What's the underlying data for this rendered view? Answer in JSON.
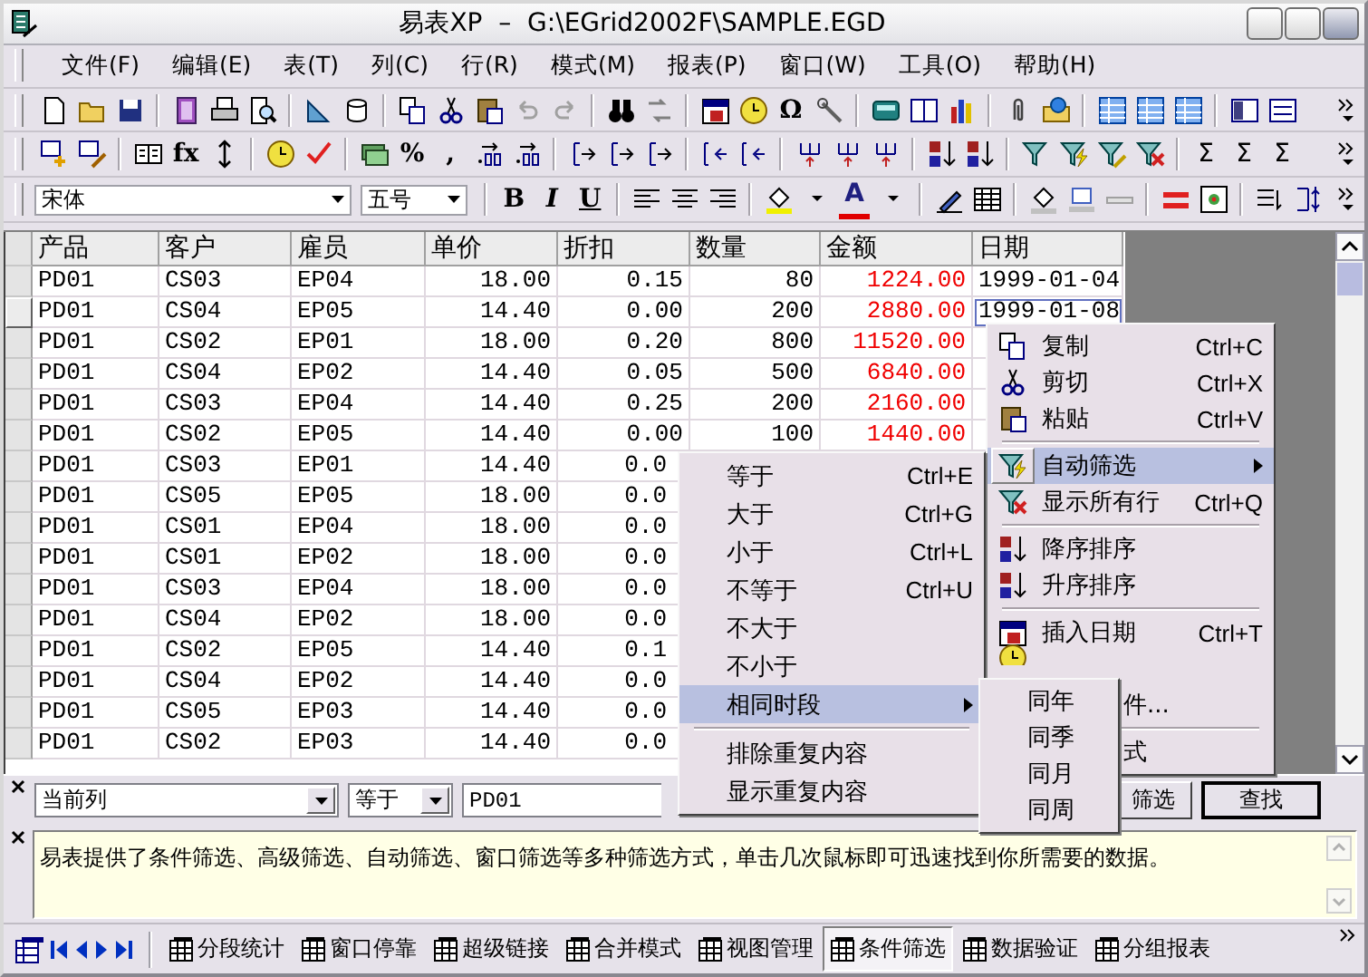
{
  "window": {
    "title": "易表XP  –  G:\\EGrid2002F\\SAMPLE.EGD"
  },
  "menu_bar": [
    "文件(F)",
    "编辑(E)",
    "表(T)",
    "列(C)",
    "行(R)",
    "模式(M)",
    "报表(P)",
    "窗口(W)",
    "工具(O)",
    "帮助(H)"
  ],
  "toolbars": {
    "omega": "Ω",
    "fx": "fx",
    "percent": "%",
    "comma": ",",
    "sigma": [
      "Σ",
      "Σ",
      "Σ"
    ],
    "font": "宋体",
    "size": "五号",
    "bold": "B",
    "italic": "I",
    "underline": "U",
    "font_color": "A"
  },
  "table": {
    "columns": [
      "产品",
      "客户",
      "雇员",
      "单价",
      "折扣",
      "数量",
      "金额",
      "日期"
    ],
    "rows": [
      {
        "selected": false,
        "covered": false,
        "cells": [
          "PD01",
          "CS03",
          "EP04",
          "18.00",
          "0.15",
          "80",
          "1224.00",
          "1999-01-04"
        ]
      },
      {
        "selected": true,
        "covered": false,
        "cells": [
          "PD01",
          "CS04",
          "EP05",
          "14.40",
          "0.00",
          "200",
          "2880.00",
          "1999-01-08"
        ]
      },
      {
        "selected": false,
        "covered": false,
        "cells": [
          "PD01",
          "CS02",
          "EP01",
          "18.00",
          "0.20",
          "800",
          "11520.00"
        ]
      },
      {
        "selected": false,
        "covered": false,
        "cells": [
          "PD01",
          "CS04",
          "EP02",
          "14.40",
          "0.05",
          "500",
          "6840.00"
        ]
      },
      {
        "selected": false,
        "covered": false,
        "cells": [
          "PD01",
          "CS03",
          "EP04",
          "14.40",
          "0.25",
          "200",
          "2160.00"
        ]
      },
      {
        "selected": false,
        "covered": false,
        "cells": [
          "PD01",
          "CS02",
          "EP05",
          "14.40",
          "0.00",
          "100",
          "1440.00"
        ]
      },
      {
        "selected": false,
        "covered": true,
        "cells": [
          "PD01",
          "CS03",
          "EP01",
          "14.40",
          "0.0"
        ]
      },
      {
        "selected": false,
        "covered": true,
        "cells": [
          "PD01",
          "CS05",
          "EP05",
          "18.00",
          "0.0"
        ]
      },
      {
        "selected": false,
        "covered": true,
        "cells": [
          "PD01",
          "CS01",
          "EP04",
          "18.00",
          "0.0"
        ]
      },
      {
        "selected": false,
        "covered": true,
        "cells": [
          "PD01",
          "CS01",
          "EP02",
          "18.00",
          "0.0"
        ]
      },
      {
        "selected": false,
        "covered": true,
        "cells": [
          "PD01",
          "CS03",
          "EP04",
          "18.00",
          "0.0"
        ]
      },
      {
        "selected": false,
        "covered": true,
        "cells": [
          "PD01",
          "CS04",
          "EP02",
          "18.00",
          "0.0"
        ]
      },
      {
        "selected": false,
        "covered": true,
        "cells": [
          "PD01",
          "CS02",
          "EP05",
          "14.40",
          "0.1"
        ]
      },
      {
        "selected": false,
        "covered": true,
        "cells": [
          "PD01",
          "CS04",
          "EP02",
          "14.40",
          "0.0"
        ]
      },
      {
        "selected": false,
        "covered": true,
        "cells": [
          "PD01",
          "CS05",
          "EP03",
          "14.40",
          "0.0"
        ]
      },
      {
        "selected": false,
        "covered": true,
        "cells": [
          "PD01",
          "CS02",
          "EP03",
          "14.40",
          "0.0"
        ]
      }
    ]
  },
  "context_menu": {
    "items": [
      {
        "kind": "item",
        "label": "复制",
        "shortcut": "Ctrl+C",
        "selected": false,
        "submenu": false
      },
      {
        "kind": "item",
        "label": "剪切",
        "shortcut": "Ctrl+X",
        "selected": false,
        "submenu": false
      },
      {
        "kind": "item",
        "label": "粘贴",
        "shortcut": "Ctrl+V",
        "selected": false,
        "submenu": false
      },
      {
        "kind": "separator"
      },
      {
        "kind": "item",
        "label": "自动筛选",
        "selected": true,
        "submenu": true
      },
      {
        "kind": "item",
        "label": "显示所有行",
        "shortcut": "Ctrl+Q",
        "selected": false,
        "submenu": false
      },
      {
        "kind": "separator"
      },
      {
        "kind": "item",
        "label": "降序排序",
        "selected": false,
        "submenu": false
      },
      {
        "kind": "item",
        "label": "升序排序",
        "selected": false,
        "submenu": false
      },
      {
        "kind": "separator"
      },
      {
        "kind": "item",
        "label": "插入日期",
        "shortcut": "Ctrl+T",
        "selected": false,
        "submenu": false
      },
      {
        "kind": "covered"
      },
      {
        "kind": "partial",
        "label": "件..."
      },
      {
        "kind": "separator"
      },
      {
        "kind": "partial",
        "label": "式"
      }
    ]
  },
  "filter_submenu": {
    "items": [
      {
        "kind": "item",
        "label": "等于",
        "shortcut": "Ctrl+E",
        "selected": false,
        "submenu": false
      },
      {
        "kind": "item",
        "label": "大于",
        "shortcut": "Ctrl+G",
        "selected": false,
        "submenu": false
      },
      {
        "kind": "item",
        "label": "小于",
        "shortcut": "Ctrl+L",
        "selected": false,
        "submenu": false
      },
      {
        "kind": "item",
        "label": "不等于",
        "shortcut": "Ctrl+U",
        "selected": false,
        "submenu": false
      },
      {
        "kind": "item",
        "label": "不大于",
        "selected": false,
        "submenu": false
      },
      {
        "kind": "item",
        "label": "不小于",
        "selected": false,
        "submenu": false
      },
      {
        "kind": "item",
        "label": "相同时段",
        "selected": true,
        "submenu": true
      },
      {
        "kind": "separator"
      },
      {
        "kind": "item",
        "label": "排除重复内容",
        "selected": false,
        "submenu": false
      },
      {
        "kind": "item",
        "label": "显示重复内容",
        "selected": false,
        "submenu": false
      }
    ]
  },
  "period_submenu": {
    "items": [
      {
        "kind": "item",
        "label": "同年",
        "selected": false,
        "submenu": false
      },
      {
        "kind": "item",
        "label": "同季",
        "selected": false,
        "submenu": false
      },
      {
        "kind": "item",
        "label": "同月",
        "selected": false,
        "submenu": false
      },
      {
        "kind": "item",
        "label": "同周",
        "selected": false,
        "submenu": false
      }
    ]
  },
  "filter_bar": {
    "scope": "当前列",
    "operator": "等于",
    "value": "PD01",
    "buttons": [
      "筛选",
      "查找"
    ]
  },
  "info": {
    "text": "易表提供了条件筛选、高级筛选、自动筛选、窗口筛选等多种筛选方式，单击几次鼠标即可迅速找到你所需要的数据。"
  },
  "tabs": [
    {
      "label": "分段统计",
      "selected": false
    },
    {
      "label": "窗口停靠",
      "selected": false
    },
    {
      "label": "超级链接",
      "selected": false
    },
    {
      "label": "合并模式",
      "selected": false
    },
    {
      "label": "视图管理",
      "selected": false
    },
    {
      "label": "条件筛选",
      "selected": true
    },
    {
      "label": "数据验证",
      "selected": false
    },
    {
      "label": "分组报表",
      "selected": false
    }
  ]
}
